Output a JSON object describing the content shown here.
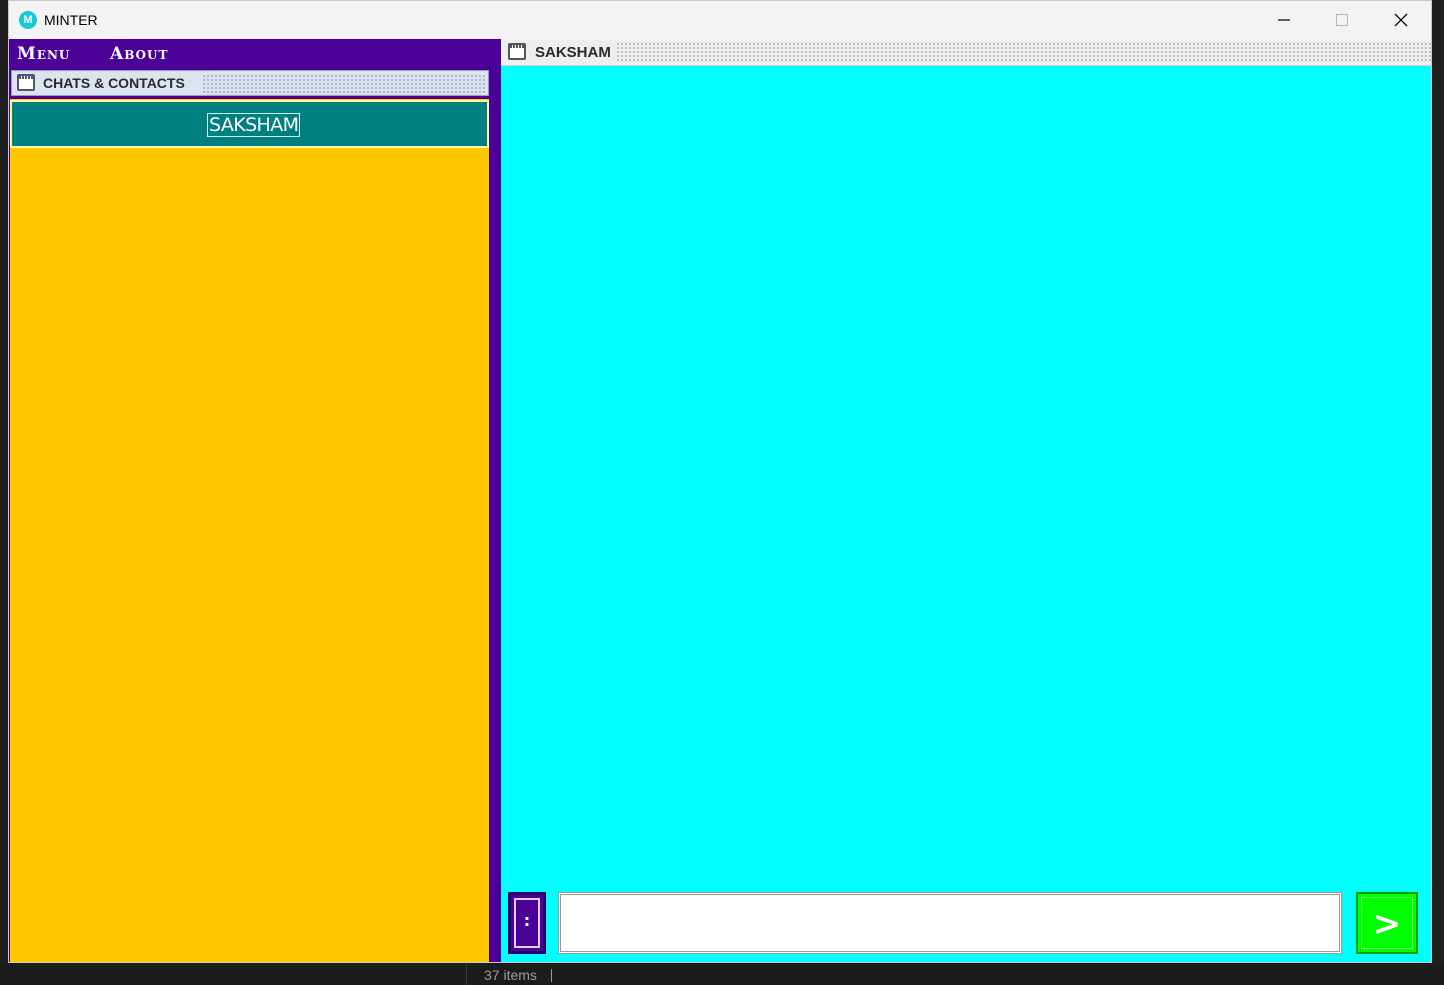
{
  "window": {
    "app_logo": "M",
    "title": "MINTER",
    "icons": [
      "minimize-icon",
      "maximize-icon",
      "close-icon"
    ]
  },
  "menubar": {
    "menu_label": "Menu",
    "about_label": "About"
  },
  "contacts_frame": {
    "title": "CHATS & CONTACTS",
    "contacts": [
      {
        "name": "SAKSHAM"
      }
    ]
  },
  "chat_frame": {
    "title": "SAKSHAM",
    "options_label": ":",
    "message_input": {
      "value": "",
      "placeholder": ""
    },
    "send_label": ">"
  },
  "colors": {
    "menubar_bg": "#4b0097",
    "contacts_bg": "#ffc800",
    "contact_item_bg": "#008080",
    "chat_bg": "#00ffff",
    "send_button_bg": "#00ff00"
  },
  "taskbar": {
    "status_text": "37 items"
  }
}
